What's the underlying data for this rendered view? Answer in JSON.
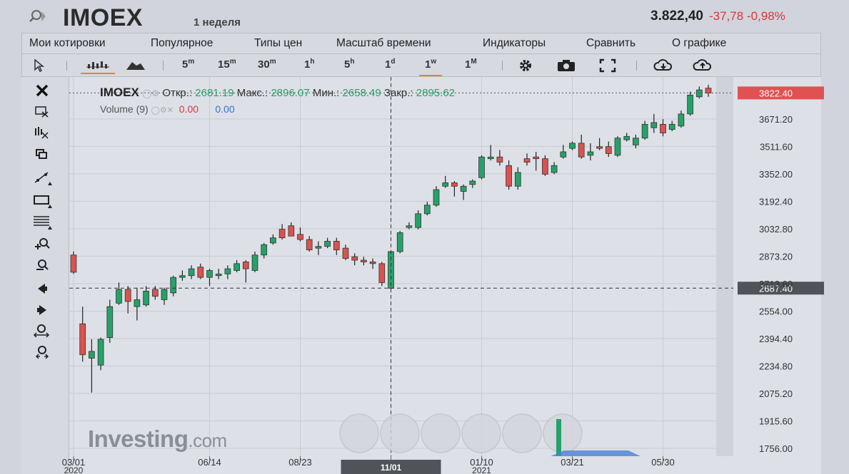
{
  "header": {
    "ticker": "IMOEX",
    "period": "1 неделя",
    "price": "3.822,40",
    "change": "-37,78",
    "change_pct": "-0,98%"
  },
  "menu": [
    "Мои котировки",
    "Популярное",
    "Типы цен",
    "Масштаб времени",
    "Индикаторы",
    "Сравнить",
    "О графике"
  ],
  "toolbar": {
    "timeframes": [
      {
        "base": "5",
        "sup": "m"
      },
      {
        "base": "15",
        "sup": "m"
      },
      {
        "base": "30",
        "sup": "m"
      },
      {
        "base": "1",
        "sup": "h"
      },
      {
        "base": "5",
        "sup": "h"
      },
      {
        "base": "1",
        "sup": "d"
      },
      {
        "base": "1",
        "sup": "w"
      },
      {
        "base": "1",
        "sup": "M"
      }
    ],
    "selected_timeframe": "1w"
  },
  "legend": {
    "symbol": "IMOEX",
    "open_label": "Откр.:",
    "open": "2681.19",
    "high_label": "Макс.:",
    "high": "2896.07",
    "low_label": "Мин.:",
    "low": "2658.49",
    "close_label": "Закр.:",
    "close": "2895.62",
    "volume_label": "Volume (9)",
    "volume_val1": "0.00",
    "volume_val2": "0.00"
  },
  "logo": {
    "main": "Investing",
    "suffix": ".com"
  },
  "crosshair": {
    "date_label": "11/01",
    "price_label": "2687.40"
  },
  "last_price_label": "3822.40",
  "colors": {
    "up": "#26a269",
    "down": "#d9534f",
    "last_price": "#e05252",
    "accent": "#e08a1e"
  },
  "chart_data": {
    "type": "candlestick",
    "y_ticks": [
      "3671.20",
      "3511.60",
      "3352.00",
      "3192.40",
      "3032.80",
      "2873.20",
      "2713.60",
      "2554.00",
      "2394.40",
      "2234.80",
      "2075.20",
      "1915.60",
      "1756.00"
    ],
    "ylim": [
      1756.0,
      3911.0
    ],
    "x_ticks": [
      {
        "label": "03/01",
        "sub": "2020",
        "index": 0
      },
      {
        "label": "06/14",
        "sub": "",
        "index": 15
      },
      {
        "label": "08/23",
        "sub": "",
        "index": 25
      },
      {
        "label": "11/01",
        "sub": "",
        "index": 35
      },
      {
        "label": "01/10",
        "sub": "2021",
        "index": 45
      },
      {
        "label": "03/21",
        "sub": "",
        "index": 55
      },
      {
        "label": "05/30",
        "sub": "",
        "index": 65
      }
    ],
    "candles": [
      [
        2880,
        2780,
        2900,
        2770
      ],
      [
        2480,
        2300,
        2580,
        2260
      ],
      [
        2280,
        2320,
        2390,
        2080
      ],
      [
        2240,
        2390,
        2400,
        2210
      ],
      [
        2400,
        2580,
        2620,
        2370
      ],
      [
        2600,
        2680,
        2720,
        2590
      ],
      [
        2680,
        2610,
        2700,
        2540
      ],
      [
        2580,
        2620,
        2690,
        2500
      ],
      [
        2590,
        2670,
        2700,
        2580
      ],
      [
        2680,
        2640,
        2700,
        2620
      ],
      [
        2620,
        2680,
        2690,
        2590
      ],
      [
        2660,
        2750,
        2760,
        2640
      ],
      [
        2750,
        2760,
        2790,
        2730
      ],
      [
        2760,
        2800,
        2820,
        2740
      ],
      [
        2810,
        2750,
        2830,
        2740
      ],
      [
        2750,
        2790,
        2800,
        2700
      ],
      [
        2760,
        2770,
        2800,
        2740
      ],
      [
        2770,
        2800,
        2820,
        2740
      ],
      [
        2790,
        2830,
        2850,
        2780
      ],
      [
        2840,
        2800,
        2850,
        2720
      ],
      [
        2790,
        2880,
        2900,
        2780
      ],
      [
        2880,
        2940,
        2950,
        2860
      ],
      [
        2950,
        2980,
        3000,
        2940
      ],
      [
        3030,
        2980,
        3060,
        2970
      ],
      [
        3050,
        2990,
        3070,
        2990
      ],
      [
        3000,
        2970,
        3040,
        2960
      ],
      [
        2970,
        2910,
        2990,
        2900
      ],
      [
        2920,
        2930,
        2960,
        2880
      ],
      [
        2930,
        2960,
        2980,
        2920
      ],
      [
        2960,
        2910,
        2980,
        2880
      ],
      [
        2920,
        2860,
        2940,
        2850
      ],
      [
        2870,
        2850,
        2890,
        2820
      ],
      [
        2850,
        2840,
        2870,
        2820
      ],
      [
        2840,
        2830,
        2860,
        2800
      ],
      [
        2830,
        2720,
        2840,
        2700
      ],
      [
        2687,
        2900,
        2900,
        2680
      ],
      [
        2900,
        3010,
        3020,
        2890
      ],
      [
        3040,
        3050,
        3070,
        3030
      ],
      [
        3040,
        3120,
        3140,
        3030
      ],
      [
        3120,
        3170,
        3190,
        3110
      ],
      [
        3170,
        3260,
        3280,
        3160
      ],
      [
        3280,
        3300,
        3340,
        3270
      ],
      [
        3300,
        3280,
        3310,
        3220
      ],
      [
        3250,
        3280,
        3290,
        3200
      ],
      [
        3290,
        3310,
        3320,
        3270
      ],
      [
        3330,
        3450,
        3460,
        3320
      ],
      [
        3440,
        3450,
        3520,
        3430
      ],
      [
        3450,
        3420,
        3490,
        3400
      ],
      [
        3400,
        3280,
        3430,
        3260
      ],
      [
        3280,
        3360,
        3390,
        3260
      ],
      [
        3440,
        3420,
        3470,
        3400
      ],
      [
        3450,
        3440,
        3480,
        3370
      ],
      [
        3440,
        3350,
        3460,
        3340
      ],
      [
        3360,
        3400,
        3420,
        3350
      ],
      [
        3450,
        3480,
        3520,
        3440
      ],
      [
        3500,
        3530,
        3540,
        3490
      ],
      [
        3530,
        3450,
        3580,
        3440
      ],
      [
        3460,
        3480,
        3530,
        3430
      ],
      [
        3510,
        3500,
        3560,
        3490
      ],
      [
        3510,
        3470,
        3540,
        3450
      ],
      [
        3460,
        3560,
        3570,
        3450
      ],
      [
        3550,
        3570,
        3590,
        3540
      ],
      [
        3520,
        3560,
        3580,
        3500
      ],
      [
        3560,
        3640,
        3660,
        3550
      ],
      [
        3620,
        3650,
        3700,
        3590
      ],
      [
        3640,
        3590,
        3670,
        3570
      ],
      [
        3610,
        3640,
        3660,
        3600
      ],
      [
        3630,
        3700,
        3720,
        3620
      ],
      [
        3700,
        3810,
        3830,
        3690
      ],
      [
        3800,
        3840,
        3860,
        3790
      ],
      [
        3850,
        3822,
        3870,
        3800
      ]
    ],
    "last_price": 3822.4,
    "crosshair_price": 2687.4,
    "crosshair_index": 35
  }
}
